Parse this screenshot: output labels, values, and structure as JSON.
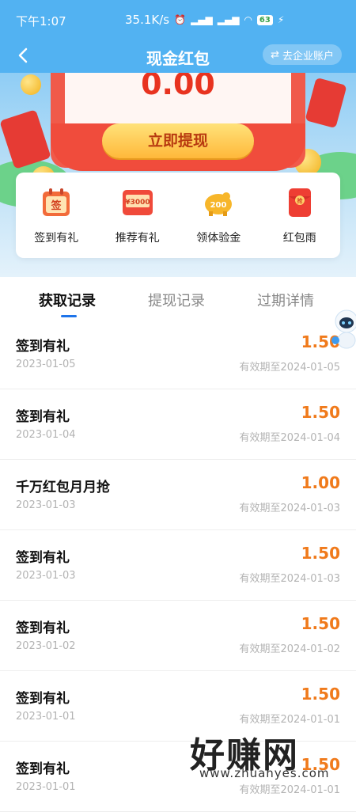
{
  "status_bar": {
    "time": "下午1:07",
    "network_speed": "35.1K/s",
    "battery": "63"
  },
  "nav": {
    "title": "现金红包",
    "account_link": "去企业账户"
  },
  "hero": {
    "balance": "0.00",
    "withdraw_label": "立即提现"
  },
  "features": [
    {
      "label": "签到有礼",
      "icon": "calendar-sign-icon",
      "badge": "签"
    },
    {
      "label": "推荐有礼",
      "icon": "coupon-3000-icon",
      "badge": "¥3000"
    },
    {
      "label": "领体验金",
      "icon": "piggy-bank-icon",
      "badge": "200"
    },
    {
      "label": "红包雨",
      "icon": "red-envelope-icon",
      "badge": "抢"
    }
  ],
  "tabs": [
    "获取记录",
    "提现记录",
    "过期详情"
  ],
  "records": [
    {
      "title": "签到有礼",
      "date": "2023-01-05",
      "amount": "1.50",
      "expire": "有效期至2024-01-05"
    },
    {
      "title": "签到有礼",
      "date": "2023-01-04",
      "amount": "1.50",
      "expire": "有效期至2024-01-04"
    },
    {
      "title": "千万红包月月抢",
      "date": "2023-01-03",
      "amount": "1.00",
      "expire": "有效期至2024-01-03"
    },
    {
      "title": "签到有礼",
      "date": "2023-01-03",
      "amount": "1.50",
      "expire": "有效期至2024-01-03"
    },
    {
      "title": "签到有礼",
      "date": "2023-01-02",
      "amount": "1.50",
      "expire": "有效期至2024-01-02"
    },
    {
      "title": "签到有礼",
      "date": "2023-01-01",
      "amount": "1.50",
      "expire": "有效期至2024-01-01"
    },
    {
      "title": "签到有礼",
      "date": "2023-01-01",
      "amount": "1.50",
      "expire": "有效期至2024-01-01"
    }
  ],
  "watermark": {
    "text": "好赚网",
    "url": "www.zhuanyes.com"
  },
  "colors": {
    "header_blue": "#52b2f2",
    "amount_orange": "#f07a1b",
    "balance_red": "#e8331f",
    "tab_underline": "#1e74ea"
  }
}
